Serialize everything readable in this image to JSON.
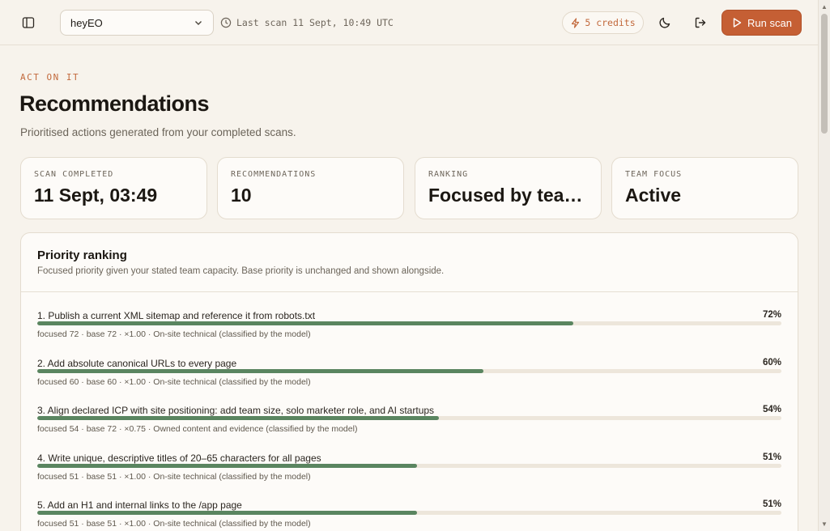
{
  "topbar": {
    "project": "heyEO",
    "last_scan": "Last scan 11 Sept, 10:49 UTC",
    "credits": "5 credits",
    "run_label": "Run scan"
  },
  "header": {
    "eyebrow": "ACT ON IT",
    "title": "Recommendations",
    "subtitle": "Prioritised actions generated from your completed scans."
  },
  "stats": [
    {
      "label": "SCAN COMPLETED",
      "value": "11 Sept, 03:49"
    },
    {
      "label": "RECOMMENDATIONS",
      "value": "10"
    },
    {
      "label": "RANKING",
      "value": "Focused by team capacity"
    },
    {
      "label": "TEAM FOCUS",
      "value": "Active"
    }
  ],
  "panel": {
    "title": "Priority ranking",
    "description": "Focused priority given your stated team capacity. Base priority is unchanged and shown alongside."
  },
  "ranking": [
    {
      "title": "1. Publish a current XML sitemap and reference it from robots.txt",
      "pct_label": "72%",
      "progress": 0.72,
      "meta": "focused 72 · base 72 · ×1.00 · On-site technical (classified by the model)"
    },
    {
      "title": "2. Add absolute canonical URLs to every page",
      "pct_label": "60%",
      "progress": 0.6,
      "meta": "focused 60 · base 60 · ×1.00 · On-site technical (classified by the model)"
    },
    {
      "title": "3. Align declared ICP with site positioning: add team size, solo marketer role, and AI startups",
      "pct_label": "54%",
      "progress": 0.54,
      "meta": "focused 54 · base 72 · ×0.75 · Owned content and evidence (classified by the model)"
    },
    {
      "title": "4. Write unique, descriptive titles of 20–65 characters for all pages",
      "pct_label": "51%",
      "progress": 0.51,
      "meta": "focused 51 · base 51 · ×1.00 · On-site technical (classified by the model)"
    },
    {
      "title": "5. Add an H1 and internal links to the /app page",
      "pct_label": "51%",
      "progress": 0.51,
      "meta": "focused 51 · base 51 · ×1.00 · On-site technical (classified by the model)"
    }
  ]
}
